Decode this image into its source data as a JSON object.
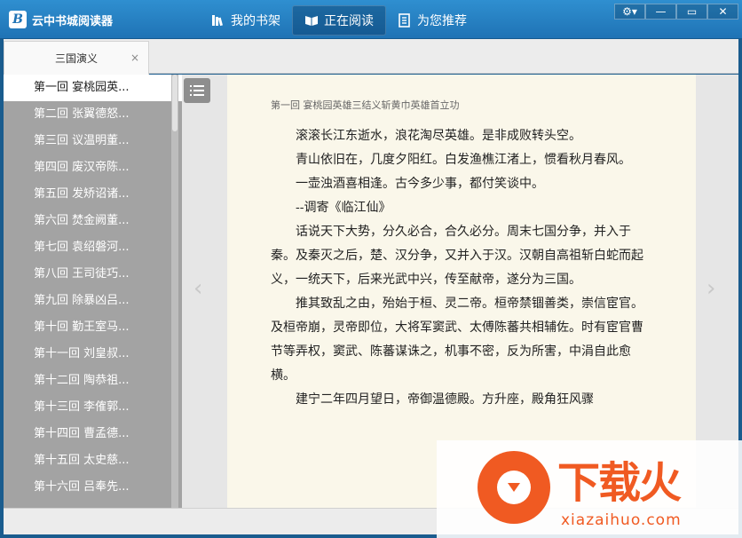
{
  "app": {
    "logo_letter": "B",
    "title": "云中书城阅读器"
  },
  "nav": [
    {
      "label": "我的书架",
      "icon": "bookshelf-icon"
    },
    {
      "label": "正在阅读",
      "icon": "reading-icon"
    },
    {
      "label": "为您推荐",
      "icon": "recommend-icon"
    }
  ],
  "window_controls": {
    "settings": "⚙▾",
    "minimize": "—",
    "maximize": "▭",
    "close": "✕"
  },
  "doc_tab": {
    "label": "三国演义",
    "close": "×"
  },
  "chapters": [
    "第一回  宴桃园英...",
    "第二回  张翼德怒...",
    "第三回  议温明董...",
    "第四回  废汉帝陈...",
    "第五回  发矫诏诸...",
    "第六回  焚金阙董...",
    "第七回  袁绍磐河...",
    "第八回  王司徒巧...",
    "第九回  除暴凶吕...",
    "第十回  勤王室马...",
    "第十一回  刘皇叔...",
    "第十二回  陶恭祖...",
    "第十三回  李傕郭...",
    "第十四回  曹孟德...",
    "第十五回  太史慈...",
    "第十六回  吕奉先..."
  ],
  "page": {
    "heading": "第一回 宴桃园英雄三结义斩黄巾英雄首立功",
    "paragraphs": [
      "滚滚长江东逝水，浪花淘尽英雄。是非成败转头空。",
      "青山依旧在，几度夕阳红。白发渔樵江渚上，惯看秋月春风。",
      "一壶浊酒喜相逢。古今多少事，都付笑谈中。",
      "--调寄《临江仙》",
      "话说天下大势，分久必合，合久必分。周末七国分争，并入于秦。及秦灭之后，楚、汉分争，又并入于汉。汉朝自高祖斩白蛇而起义，一统天下，后来光武中兴，传至献帝，遂分为三国。",
      "推其致乱之由，殆始于桓、灵二帝。桓帝禁锢善类，崇信宦官。及桓帝崩，灵帝即位，大将军窦武、太傅陈蕃共相辅佐。时有宦官曹节等弄权，窦武、陈蕃谋诛之，机事不密，反为所害，中涓自此愈横。",
      "建宁二年四月望日，帝御温德殿。方升座，殿角狂风骤"
    ],
    "prev_arrow": "‹",
    "next_arrow": "›"
  },
  "watermark": {
    "title": "下载火",
    "url": "xiazaihuo.com"
  },
  "colors": {
    "titlebar": "#1f73b5",
    "sidebar": "#a3a3a3",
    "page": "#faf7ea",
    "watermark": "#f05a22"
  }
}
